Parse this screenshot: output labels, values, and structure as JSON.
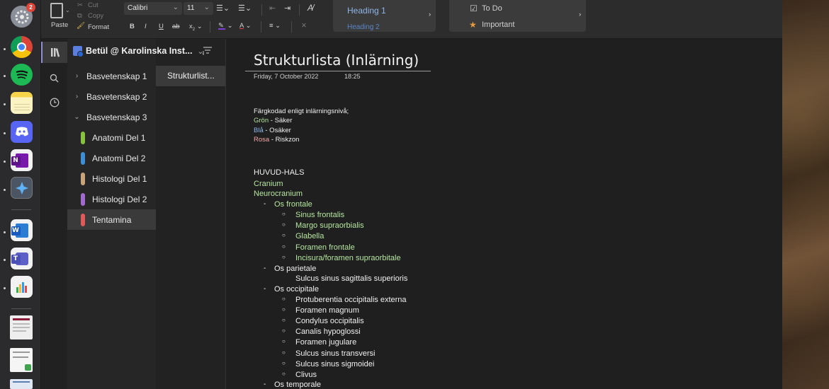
{
  "dock": {
    "badge_count": "2",
    "apps": [
      "system-preferences",
      "chrome",
      "spotify",
      "notes",
      "discord",
      "onenote",
      "app-store-alt",
      "word",
      "teams",
      "numbers"
    ]
  },
  "ribbon": {
    "paste": "Paste",
    "cut": "Cut",
    "copy": "Copy",
    "format": "Format",
    "font_name": "Calibri",
    "font_size": "11",
    "bold": "B",
    "italic": "I",
    "underline": "U",
    "strike": "ab",
    "subscript": "x",
    "styles": [
      "Heading 1",
      "Heading 2"
    ],
    "tags": [
      "To Do",
      "Important"
    ],
    "colors": {
      "highlight": "#7b3fd6",
      "font_color": "#e04848",
      "tag_star": "#e89a3c"
    }
  },
  "notebook": {
    "name": "Betül @ Karolinska Inst...",
    "sections": [
      {
        "label": "Basvetenskap 1",
        "type": "group",
        "expanded": false
      },
      {
        "label": "Basvetenskap 2",
        "type": "group",
        "expanded": false
      },
      {
        "label": "Basvetenskap 3",
        "type": "group",
        "expanded": true
      },
      {
        "label": "Anatomi Del 1",
        "type": "section",
        "color": "#86c23e"
      },
      {
        "label": "Anatomi Del 2",
        "type": "section",
        "color": "#3e8ed6"
      },
      {
        "label": "Histologi Del 1",
        "type": "section",
        "color": "#c9a47a"
      },
      {
        "label": "Histologi Del 2",
        "type": "section",
        "color": "#a16ad0"
      },
      {
        "label": "Tentamina",
        "type": "section",
        "color": "#e05a5a",
        "selected": true
      }
    ],
    "pages": [
      "Strukturlist..."
    ]
  },
  "note": {
    "title": "Strukturlista (Inlärning)",
    "date": "Friday, 7 October 2022",
    "time": "18:25",
    "intro": "Färgkodad enligt inlärningsnivå;",
    "legend": [
      {
        "color_word": "Grön",
        "rest": " - Säker"
      },
      {
        "color_word": "Blå",
        "rest": " - Osäker"
      },
      {
        "color_word": "Rosa",
        "rest": " - Riskzon"
      }
    ],
    "heading": "HUVUD-HALS",
    "cranium": "Cranium",
    "neurocranium": "Neurocranium",
    "os_frontale": "Os frontale",
    "frontale_items": [
      "Sinus frontalis",
      "Margo supraorbialis",
      "Glabella",
      "Foramen frontale",
      "Incisura/foramen supraorbitale"
    ],
    "os_parietale": "Os parietale",
    "parietale_items": [
      "Sulcus sinus sagittalis superioris"
    ],
    "os_occipitale": "Os occipitale",
    "occipitale_items": [
      "Protuberentia occipitalis externa",
      "Foramen magnum",
      "Condylus occipitalis",
      "Canalis hypoglossi",
      "Foramen jugulare",
      "Sulcus sinus transversi",
      "Sulcus sinus sigmoidei",
      "Clivus"
    ],
    "os_temporale": "Os temporale"
  }
}
